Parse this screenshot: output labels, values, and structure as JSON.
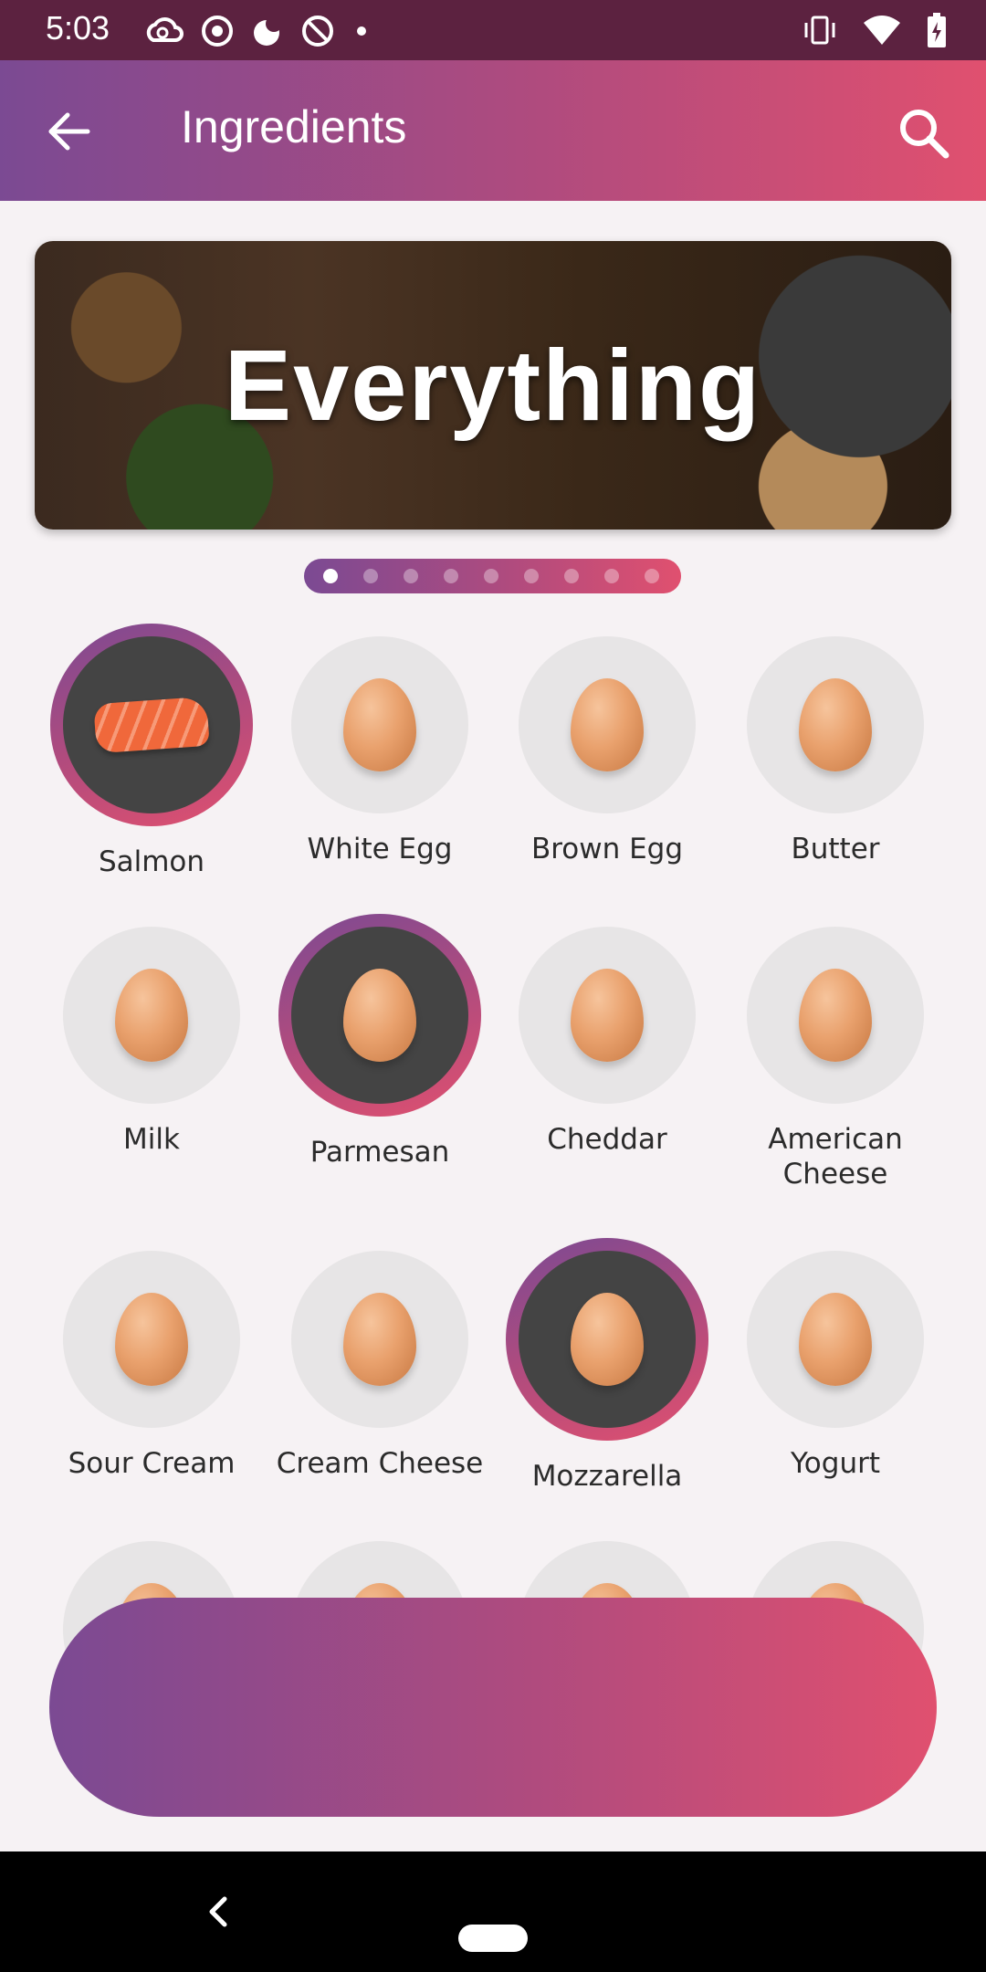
{
  "status_bar": {
    "time": "5:03",
    "left_icons": [
      "creative-cloud-icon",
      "chrome-icon",
      "moon-icon",
      "no-sign-icon",
      "dot-icon"
    ],
    "right_icons": [
      "vibrate-icon",
      "wifi-icon",
      "battery-charging-icon"
    ]
  },
  "app_bar": {
    "title": "Ingredients",
    "back_icon": "arrow-back-icon",
    "search_icon": "search-icon"
  },
  "banner": {
    "title": "Everything",
    "pages": 9,
    "active_page": 1
  },
  "ingredients": [
    {
      "label": "Salmon",
      "selected": true,
      "image": "salmon"
    },
    {
      "label": "White Egg",
      "selected": false,
      "image": "egg"
    },
    {
      "label": "Brown Egg",
      "selected": false,
      "image": "egg"
    },
    {
      "label": "Butter",
      "selected": false,
      "image": "egg"
    },
    {
      "label": "Milk",
      "selected": false,
      "image": "egg"
    },
    {
      "label": "Parmesan",
      "selected": true,
      "image": "egg"
    },
    {
      "label": "Cheddar",
      "selected": false,
      "image": "egg"
    },
    {
      "label": "American Cheese",
      "selected": false,
      "image": "egg"
    },
    {
      "label": "Sour Cream",
      "selected": false,
      "image": "egg"
    },
    {
      "label": "Cream Cheese",
      "selected": false,
      "image": "egg"
    },
    {
      "label": "Mozzarella",
      "selected": true,
      "image": "egg"
    },
    {
      "label": "Yogurt",
      "selected": false,
      "image": "egg"
    }
  ],
  "theme": {
    "gradient_start": "#7b4a93",
    "gradient_mid": "#b04b7e",
    "gradient_end": "#e0506f",
    "selected_circle": "#444444",
    "unselected_circle": "#e7e5e6"
  }
}
